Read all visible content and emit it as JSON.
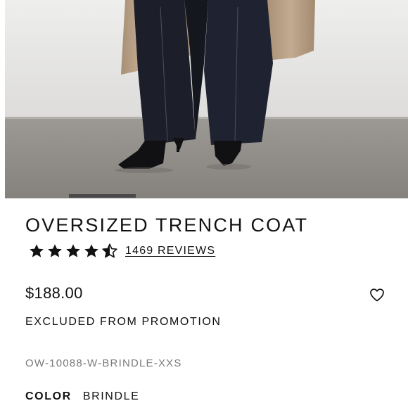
{
  "product": {
    "title": "OVERSIZED TRENCH COAT",
    "rating": {
      "stars": 4.5,
      "max_stars": 5,
      "reviews_label": "1469 REVIEWS"
    },
    "price": "$188.00",
    "promotion_note": "EXCLUDED FROM PROMOTION",
    "sku": "OW-10088-W-BRINDLE-XXS",
    "color": {
      "label": "COLOR",
      "value": "BRINDLE"
    }
  },
  "carousel": {
    "active_index": 1
  },
  "icons": {
    "star": "star-icon",
    "half_star": "star-half-icon",
    "wishlist": "heart-outline-icon"
  },
  "colors": {
    "text": "#111111",
    "muted": "#7a7a7a",
    "coat": "#b49c82",
    "trousers": "#1c1f2a",
    "floor": "#8e8b86",
    "wall": "#e5e4e2"
  }
}
